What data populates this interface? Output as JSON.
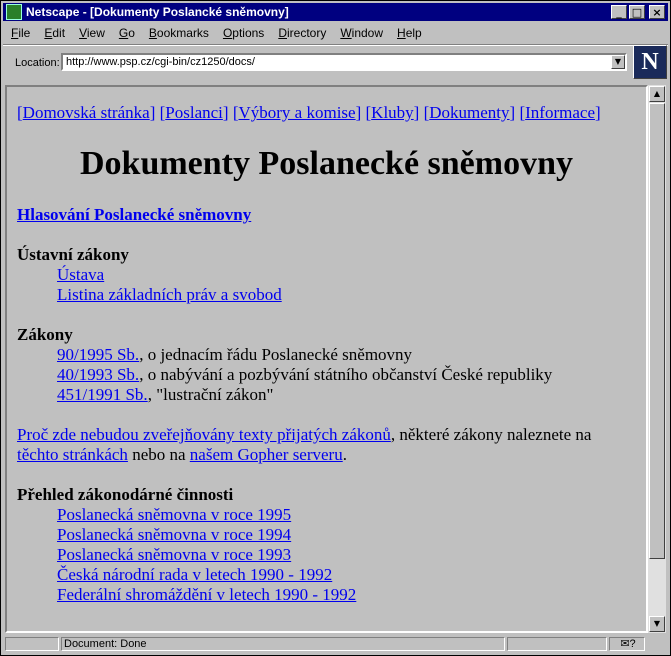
{
  "window": {
    "title": "Netscape - [Dokumenty Poslancké sněmovny]"
  },
  "menu": [
    "File",
    "Edit",
    "View",
    "Go",
    "Bookmarks",
    "Options",
    "Directory",
    "Window",
    "Help"
  ],
  "location": {
    "label": "Location:",
    "url": "http://www.psp.cz/cgi-bin/cz1250/docs/"
  },
  "nav": {
    "links": [
      "Domovská stránka",
      "Poslanci",
      "Výbory a komise",
      "Kluby",
      "Dokumenty",
      "Informace"
    ]
  },
  "page": {
    "heading": "Dokumenty Poslanecké sněmovny",
    "voting_link": "Hlasování Poslanecké sněmovny",
    "constitutional": {
      "heading": "Ústavní zákony",
      "items": [
        "Ústava",
        "Listina základních práv a svobod"
      ]
    },
    "laws": {
      "heading": "Zákony",
      "items": [
        {
          "link": "90/1995 Sb.",
          "text": ", o jednacím řádu Poslanecké sněmovny"
        },
        {
          "link": "40/1993 Sb.",
          "text": ", o nabývání a pozbývání státního občanství České republiky"
        },
        {
          "link": "451/1991 Sb.",
          "text": ", \"lustrační zákon\""
        }
      ]
    },
    "note": {
      "link1": "Proč zde nebudou zveřejňovány texty přijatých zákonů",
      "text1": ", některé zákony naleznete na",
      "link2": "těchto stránkách",
      "text2": " nebo na ",
      "link3": "našem Gopher serveru",
      "text3": "."
    },
    "overview": {
      "heading": "Přehled zákonodárné činnosti",
      "items": [
        "Poslanecká sněmovna v roce 1995",
        "Poslanecká sněmovna v roce 1994",
        "Poslanecká sněmovna v roce 1993",
        "Česká národní rada v letech 1990 - 1992",
        "Federální shromáždění v letech 1990 - 1992"
      ]
    }
  },
  "status": {
    "text": "Document: Done"
  }
}
